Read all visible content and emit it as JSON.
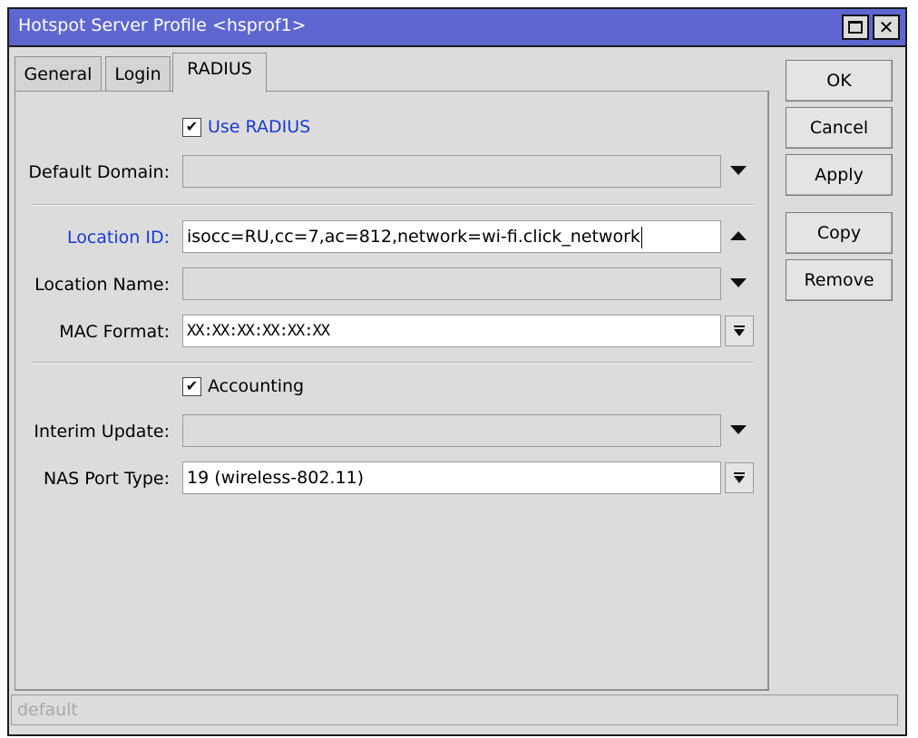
{
  "window": {
    "title": "Hotspot Server Profile <hsprof1>"
  },
  "tabs": [
    {
      "label": "General",
      "active": false
    },
    {
      "label": "Login",
      "active": false
    },
    {
      "label": "RADIUS",
      "active": true
    }
  ],
  "form": {
    "use_radius": {
      "label": "Use RADIUS",
      "checked": true
    },
    "default_domain": {
      "label": "Default Domain:",
      "value": ""
    },
    "location_id": {
      "label": "Location ID:",
      "value": "isocc=RU,cc=7,ac=812,network=wi-fi.click_network"
    },
    "location_name": {
      "label": "Location Name:",
      "value": ""
    },
    "mac_format": {
      "label": "MAC Format:",
      "value": "XX:XX:XX:XX:XX:XX"
    },
    "accounting": {
      "label": "Accounting",
      "checked": true
    },
    "interim_update": {
      "label": "Interim Update:",
      "value": ""
    },
    "nas_port_type": {
      "label": "NAS Port Type:",
      "value": "19 (wireless-802.11)"
    }
  },
  "buttons": {
    "ok": "OK",
    "cancel": "Cancel",
    "apply": "Apply",
    "copy": "Copy",
    "remove": "Remove"
  },
  "statusbar": {
    "text": "default"
  },
  "colors": {
    "titlebar": "#5e67d0",
    "highlight_label": "#1a3ad0",
    "window_bg": "#dcdcdc"
  }
}
